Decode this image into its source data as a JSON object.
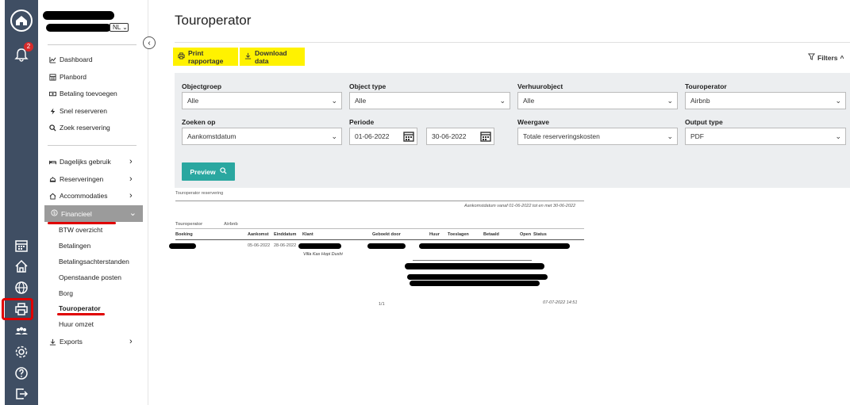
{
  "rail": {
    "notification_count": "2",
    "icons": [
      "home-logo-icon",
      "bell-icon",
      "calendar-icon",
      "home-icon",
      "globe-icon",
      "printer-icon",
      "users-icon",
      "gear-icon",
      "help-icon",
      "logout-icon"
    ]
  },
  "sidebar": {
    "language": "NL",
    "collapse_glyph": "‹",
    "primary": [
      {
        "label": "Dashboard",
        "icon": "chart-icon"
      },
      {
        "label": "Planbord",
        "icon": "calendar-grid-icon"
      },
      {
        "label": "Betaling toevoegen",
        "icon": "money-icon"
      },
      {
        "label": "Snel reserveren",
        "icon": "bolt-icon"
      },
      {
        "label": "Zoek reservering",
        "icon": "search-icon"
      }
    ],
    "groups": [
      {
        "label": "Dagelijks gebruik",
        "icon": "bed-icon"
      },
      {
        "label": "Reserveringen",
        "icon": "bell-service-icon"
      },
      {
        "label": "Accommodaties",
        "icon": "house-icon"
      }
    ],
    "active_group": {
      "label": "Financieel",
      "icon": "coin-icon"
    },
    "financieel_items": [
      "BTW overzicht",
      "Betalingen",
      "Betalingsachterstanden",
      "Openstaande posten",
      "Borg",
      "Touroperator",
      "Huur omzet"
    ],
    "exports": {
      "label": "Exports",
      "icon": "download-icon"
    }
  },
  "main": {
    "title": "Touroperator",
    "print_label": "Print rapportage",
    "download_label": "Download data",
    "filters_label": "Filters",
    "filters": {
      "objectgroep": {
        "label": "Objectgroep",
        "value": "Alle"
      },
      "object_type": {
        "label": "Object type",
        "value": "Alle"
      },
      "verhuurobject": {
        "label": "Verhuurobject",
        "value": "Alle"
      },
      "touroperator": {
        "label": "Touroperator",
        "value": "Airbnb"
      },
      "zoeken_op": {
        "label": "Zoeken op",
        "value": "Aankomstdatum"
      },
      "periode": {
        "label": "Periode",
        "from": "01-06-2022",
        "to": "30-06-2022"
      },
      "weergave": {
        "label": "Weergave",
        "value": "Totale reserveringskosten"
      },
      "output_type": {
        "label": "Output type",
        "value": "PDF"
      }
    },
    "preview_label": "Preview"
  },
  "report": {
    "heading": "Touroperator reservering",
    "range": "Aankomstdatum vanaf 01-06-2022 tot en met 30-06-2022",
    "operator_label": "Touroperator",
    "operator_value": "Airbnb",
    "columns": [
      "Boeking",
      "Aankomst",
      "Einddatum",
      "Klant",
      "Geboekt door",
      "Huur",
      "Toeslagen",
      "Betaald",
      "Open",
      "Status"
    ],
    "row": {
      "aankomst": "05-06-2022",
      "einddatum": "28-06-2022",
      "object": "Villa Kas Hopi Dushi"
    },
    "page": "1/1",
    "printed": "07-07-2022 14:51"
  }
}
